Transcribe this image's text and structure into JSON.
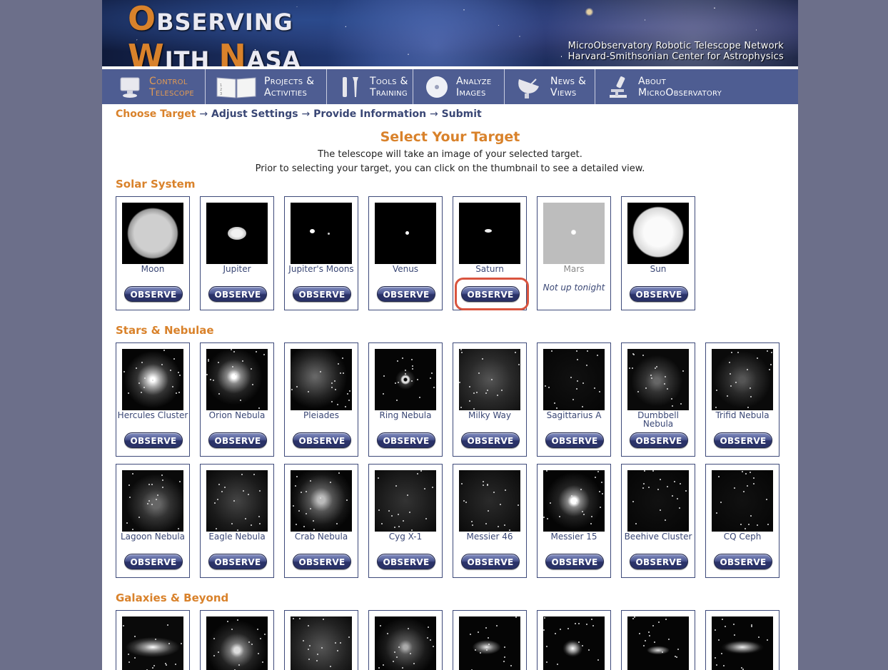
{
  "banner": {
    "logo_line1_big": "O",
    "logo_line1_rest": "BSERVING",
    "logo_line2_big1": "W",
    "logo_line2_rest1": "ITH ",
    "logo_line2_big2": "N",
    "logo_line2_rest2": "ASA",
    "sub_line1": "MicroObservatory Robotic Telescope Network",
    "sub_line2": "Harvard-Smithsonian Center for Astrophysics"
  },
  "nav": [
    {
      "line1": "Control",
      "line2": "Telescope",
      "icon": "computer-icon"
    },
    {
      "line1": "Projects &",
      "line2": "Activities",
      "icon": "book-icon"
    },
    {
      "line1": "Tools &",
      "line2": "Training",
      "icon": "tools-icon"
    },
    {
      "line1": "Analyze",
      "line2": "Images",
      "icon": "disc-icon"
    },
    {
      "line1": "News &",
      "line2": "Views",
      "icon": "satellite-dish-icon"
    },
    {
      "line1": "About",
      "line2": "MicroObservatory",
      "icon": "microscope-icon"
    }
  ],
  "breadcrumb": {
    "step1": "Choose Target",
    "step2": "Adjust Settings",
    "step3": "Provide Information",
    "step4": "Submit",
    "arrow": "→"
  },
  "page_title": "Select Your Target",
  "desc_line1": "The telescope will take an image of your selected target.",
  "desc_line2": "Prior to selecting your target, you can click on the thumbnail to see a detailed view.",
  "observe_label": "OBSERVE",
  "sections": {
    "solar": "Solar System",
    "stars": "Stars & Nebulae",
    "galaxies": "Galaxies & Beyond"
  },
  "solar_targets": [
    {
      "name": "Moon",
      "available": true
    },
    {
      "name": "Jupiter",
      "available": true
    },
    {
      "name": "Jupiter's Moons",
      "available": true
    },
    {
      "name": "Venus",
      "available": true
    },
    {
      "name": "Saturn",
      "available": true
    },
    {
      "name": "Mars",
      "available": false,
      "status": "Not up tonight"
    },
    {
      "name": "Sun",
      "available": true
    }
  ],
  "stars_row1": [
    "Hercules Cluster",
    "Orion Nebula",
    "Pleiades",
    "Ring Nebula",
    "Milky Way",
    "Sagittarius A",
    "Dumbbell Nebula",
    "Trifid Nebula"
  ],
  "stars_row2": [
    "Lagoon Nebula",
    "Eagle Nebula",
    "Crab Nebula",
    "Cyg X-1",
    "Messier 46",
    "Messier 15",
    "Beehive Cluster",
    "CQ Ceph"
  ],
  "colors": {
    "accent": "#d9822b",
    "nav_bg": "#4e5d92",
    "text_dark": "#3a4775",
    "highlight": "#d9543f"
  }
}
